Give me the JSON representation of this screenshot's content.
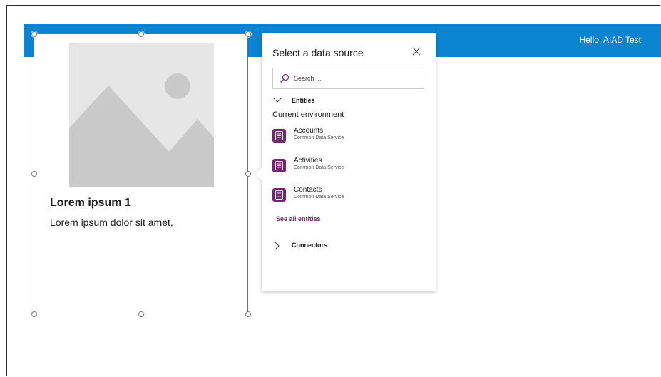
{
  "header": {
    "greeting": "Hello, AIAD Test"
  },
  "card": {
    "title": "Lorem ipsum 1",
    "subtitle": "Lorem ipsum dolor sit amet,"
  },
  "data_source_panel": {
    "title": "Select a data source",
    "search": {
      "placeholder": "Search ...",
      "value": ""
    },
    "entities_section": {
      "label": "Entities",
      "expanded": true,
      "environment_label": "Current environment",
      "items": [
        {
          "name": "Accounts",
          "service": "Common Data Service"
        },
        {
          "name": "Activities",
          "service": "Common Data Service"
        },
        {
          "name": "Contacts",
          "service": "Common Data Service"
        }
      ],
      "see_all_label": "See all entities"
    },
    "connectors_section": {
      "label": "Connectors",
      "expanded": false
    }
  },
  "colors": {
    "header_bar": "#0a84d0",
    "entity_tile": "#742774",
    "link": "#742774"
  },
  "icons": {
    "close": "close-icon",
    "search": "search-icon",
    "expand": "chevron-down-icon",
    "collapse": "chevron-right-icon",
    "entity": "entity-table-icon",
    "placeholder_image": "image-placeholder-icon"
  }
}
